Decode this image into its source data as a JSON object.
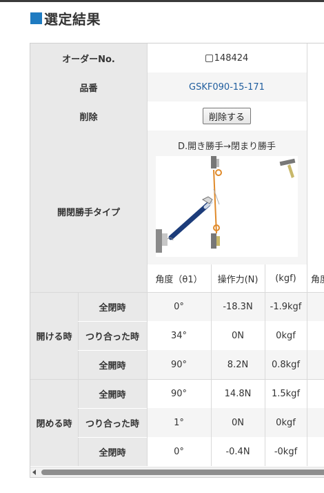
{
  "header": {
    "title": "選定結果"
  },
  "order": {
    "label": "オーダーNo.",
    "value": "148424"
  },
  "product": {
    "label": "品番",
    "value": "GSKF090-15-171"
  },
  "delete": {
    "label": "削除",
    "button": "削除する"
  },
  "type": {
    "label": "開閉勝手タイプ",
    "caption": "D.開き勝手→閉まり勝手"
  },
  "columns": {
    "angle": "角度（θ1）",
    "force": "操作力(N)",
    "kgf": "(kgf)",
    "angle_cut": "角度"
  },
  "open": {
    "label": "開ける時",
    "rows": [
      {
        "state": "全閉時",
        "angle": "0°",
        "force": "-18.3N",
        "kgf": "-1.9kgf"
      },
      {
        "state": "つり合った時",
        "angle": "34°",
        "force": "0N",
        "kgf": "0kgf"
      },
      {
        "state": "全開時",
        "angle": "90°",
        "force": "8.2N",
        "kgf": "0.8kgf"
      }
    ]
  },
  "close": {
    "label": "閉める時",
    "rows": [
      {
        "state": "全開時",
        "angle": "90°",
        "force": "14.8N",
        "kgf": "1.5kgf"
      },
      {
        "state": "つり合った時",
        "angle": "1°",
        "force": "0N",
        "kgf": "0kgf"
      },
      {
        "state": "全閉時",
        "angle": "0°",
        "force": "-0.4N",
        "kgf": "-0kgf"
      }
    ]
  },
  "colors": {
    "accent": "#1f7bc1",
    "link": "#1f5d9e",
    "label_bg": "#e9e9e9",
    "damper": "#1c3c7a",
    "hinge": "#e08a2a"
  }
}
